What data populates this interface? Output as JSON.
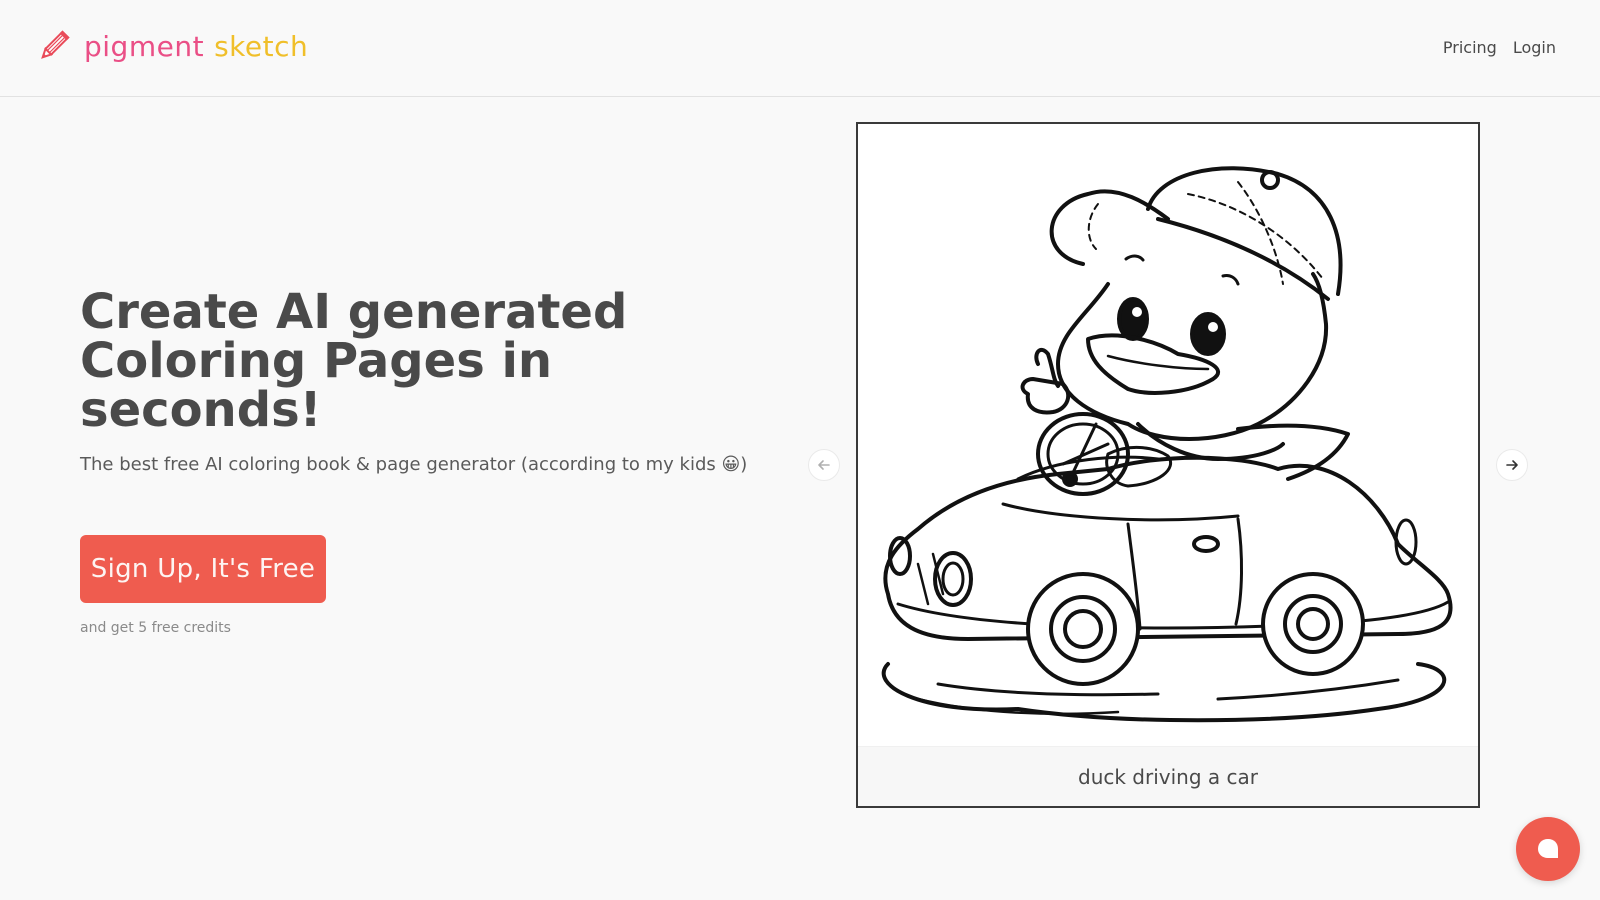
{
  "brand": {
    "name_part1": "pigment",
    "name_part2": "sketch",
    "icon": "pencil-icon"
  },
  "nav": {
    "pricing": "Pricing",
    "login": "Login"
  },
  "hero": {
    "title": "Create AI generated Coloring Pages in seconds!",
    "subtitle": "The best free AI coloring book & page generator (according to my kids 😀)",
    "cta_label": "Sign Up, It's Free",
    "cta_note": "and get 5 free credits"
  },
  "carousel": {
    "caption": "duck driving a car",
    "prev_icon": "arrow-left-icon",
    "next_icon": "arrow-right-icon"
  },
  "chat": {
    "icon": "chat-bubble-icon"
  },
  "colors": {
    "accent": "#ef5c4f",
    "text": "#4a4a4a",
    "background": "#f9f9f9"
  }
}
